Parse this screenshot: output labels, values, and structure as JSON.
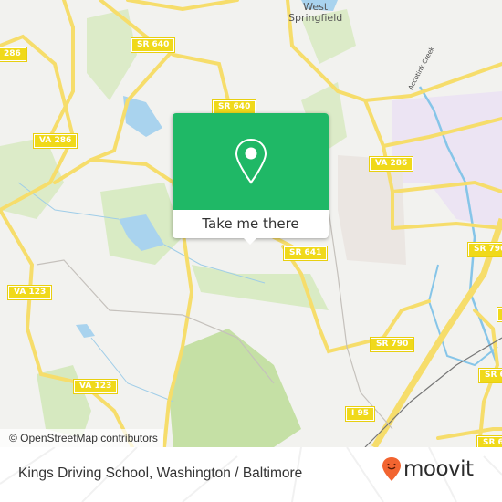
{
  "map": {
    "place_labels": [
      {
        "text_line1": "West",
        "text_line2": "Springfield"
      }
    ],
    "waterway_labels": [
      "Accotink Creek"
    ],
    "route_shields": [
      {
        "label": "286"
      },
      {
        "label": "SR 640"
      },
      {
        "label": "SR 640"
      },
      {
        "label": "VA 286"
      },
      {
        "label": "VA 286"
      },
      {
        "label": "SR 641"
      },
      {
        "label": "SR 790"
      },
      {
        "label": "VA 123"
      },
      {
        "label": "SR 790"
      },
      {
        "label": "VA 123"
      },
      {
        "label": "I 95"
      },
      {
        "label": "SR 6"
      },
      {
        "label": "SR 6"
      },
      {
        "label": "S"
      }
    ],
    "attribution": "© OpenStreetMap contributors"
  },
  "popup": {
    "icon": "map-pin-icon",
    "cta_label": "Take me there",
    "color": "#1fb866"
  },
  "footer": {
    "title": "Kings Driving School, Washington / Baltimore",
    "logo_text": "moovit",
    "logo_color": "#f26430"
  }
}
